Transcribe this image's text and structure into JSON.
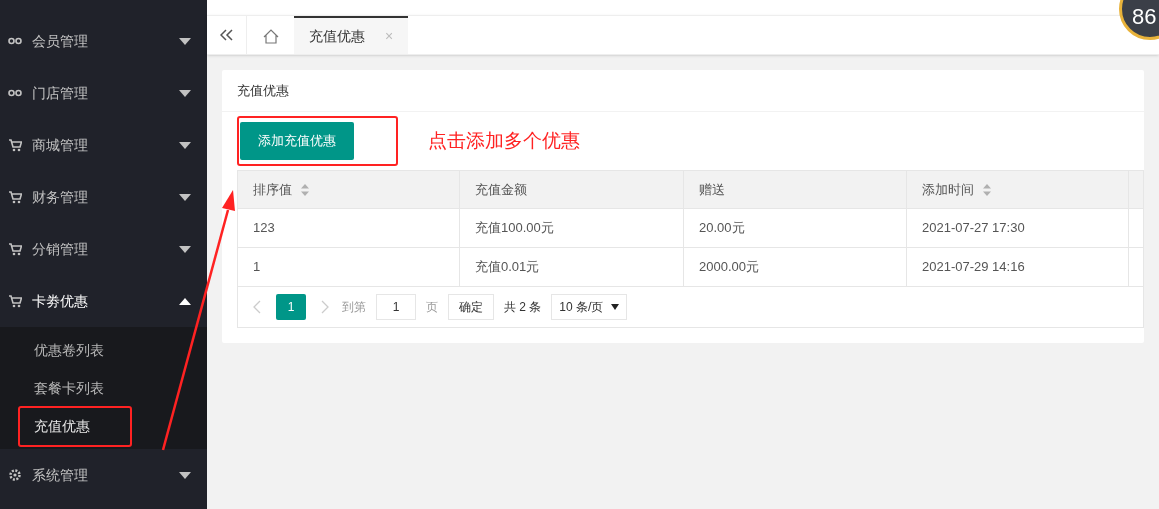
{
  "sidebar": {
    "items": [
      {
        "label": "会员管理",
        "kind": "link",
        "expanded": false
      },
      {
        "label": "门店管理",
        "kind": "link",
        "expanded": false
      },
      {
        "label": "商城管理",
        "kind": "cart",
        "expanded": false
      },
      {
        "label": "财务管理",
        "kind": "cart",
        "expanded": false
      },
      {
        "label": "分销管理",
        "kind": "cart",
        "expanded": false
      },
      {
        "label": "卡劵优惠",
        "kind": "cart",
        "expanded": true,
        "children": [
          {
            "label": "优惠卷列表",
            "selected": false,
            "annotated": false
          },
          {
            "label": "套餐卡列表",
            "selected": false,
            "annotated": false
          },
          {
            "label": "充值优惠",
            "selected": true,
            "annotated": true
          }
        ]
      },
      {
        "label": "系统管理",
        "kind": "gear",
        "expanded": false
      }
    ]
  },
  "tabs": [
    {
      "kind": "home",
      "selected": false
    },
    {
      "kind": "page",
      "label": "充值优惠",
      "close": "×",
      "selected": true
    }
  ],
  "badge": "86",
  "card": {
    "title": "充值优惠",
    "add_button": {
      "label": "添加充值优惠",
      "annotated": true
    },
    "annotation": "点击添加多个优惠",
    "table": {
      "columns": [
        {
          "label": "排序值",
          "sortable": true
        },
        {
          "label": "充值金额",
          "sortable": false
        },
        {
          "label": "赠送",
          "sortable": false
        },
        {
          "label": "添加时间",
          "sortable": true
        }
      ],
      "rows": [
        [
          "123",
          "充值100.00元",
          "20.00元",
          "2021-07-27 17:30"
        ],
        [
          "1",
          "充值0.01元",
          "2000.00元",
          "2021-07-29 14:16"
        ]
      ]
    },
    "pagination": {
      "prev_disabled": true,
      "next_disabled": true,
      "pages": [
        {
          "label": "1",
          "selected": true
        }
      ],
      "goto_label": "到第",
      "goto_value": "1",
      "page_unit": "页",
      "confirm": "确定",
      "total": "共 2 条",
      "page_size": "10 条/页"
    }
  }
}
